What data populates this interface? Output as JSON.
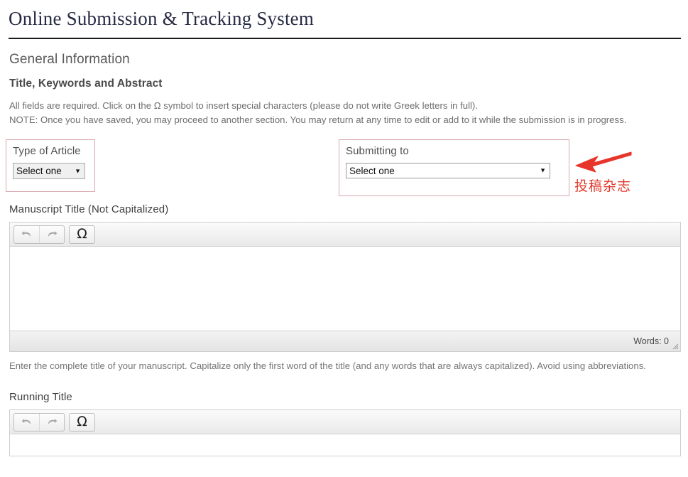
{
  "header": {
    "app_title": "Online Submission & Tracking System"
  },
  "section": {
    "heading": "General Information",
    "sub_heading": "Title, Keywords and Abstract",
    "instructions_line1": "All fields are required. Click on the Ω symbol to insert special characters (please do not write Greek letters in full).",
    "instructions_line2": "NOTE: Once you have saved, you may proceed to another section. You may return at any time to edit or add to it while the submission is in progress."
  },
  "type_of_article": {
    "legend": "Type of Article",
    "selected": "Select one",
    "options": [
      "Select one"
    ],
    "caret": "▼"
  },
  "submitting_to": {
    "legend": "Submitting to",
    "selected": "Select one",
    "options": [
      "Select one"
    ],
    "caret": "▼"
  },
  "annotation": {
    "text": "投稿杂志",
    "color": "#e0392c",
    "arrow_icon": "left-arrow-icon"
  },
  "manuscript_title": {
    "label": "Manuscript Title (Not Capitalized)",
    "toolbar": {
      "undo_label": "Undo",
      "redo_label": "Redo",
      "omega_label": "Ω"
    },
    "body_value": "",
    "words_status": "Words: 0",
    "help_text": "Enter the complete title of your manuscript. Capitalize only the first word of the title (and any words that are always capitalized). Avoid using abbreviations."
  },
  "running_title": {
    "label": "Running Title",
    "toolbar": {
      "undo_label": "Undo",
      "redo_label": "Redo",
      "omega_label": "Ω"
    },
    "body_value": ""
  },
  "colors": {
    "title_navy": "#262b44",
    "fieldset_border_pink": "#d9a7ae",
    "annotation_red": "#e0392c",
    "rule_black": "#1b1b1b"
  }
}
